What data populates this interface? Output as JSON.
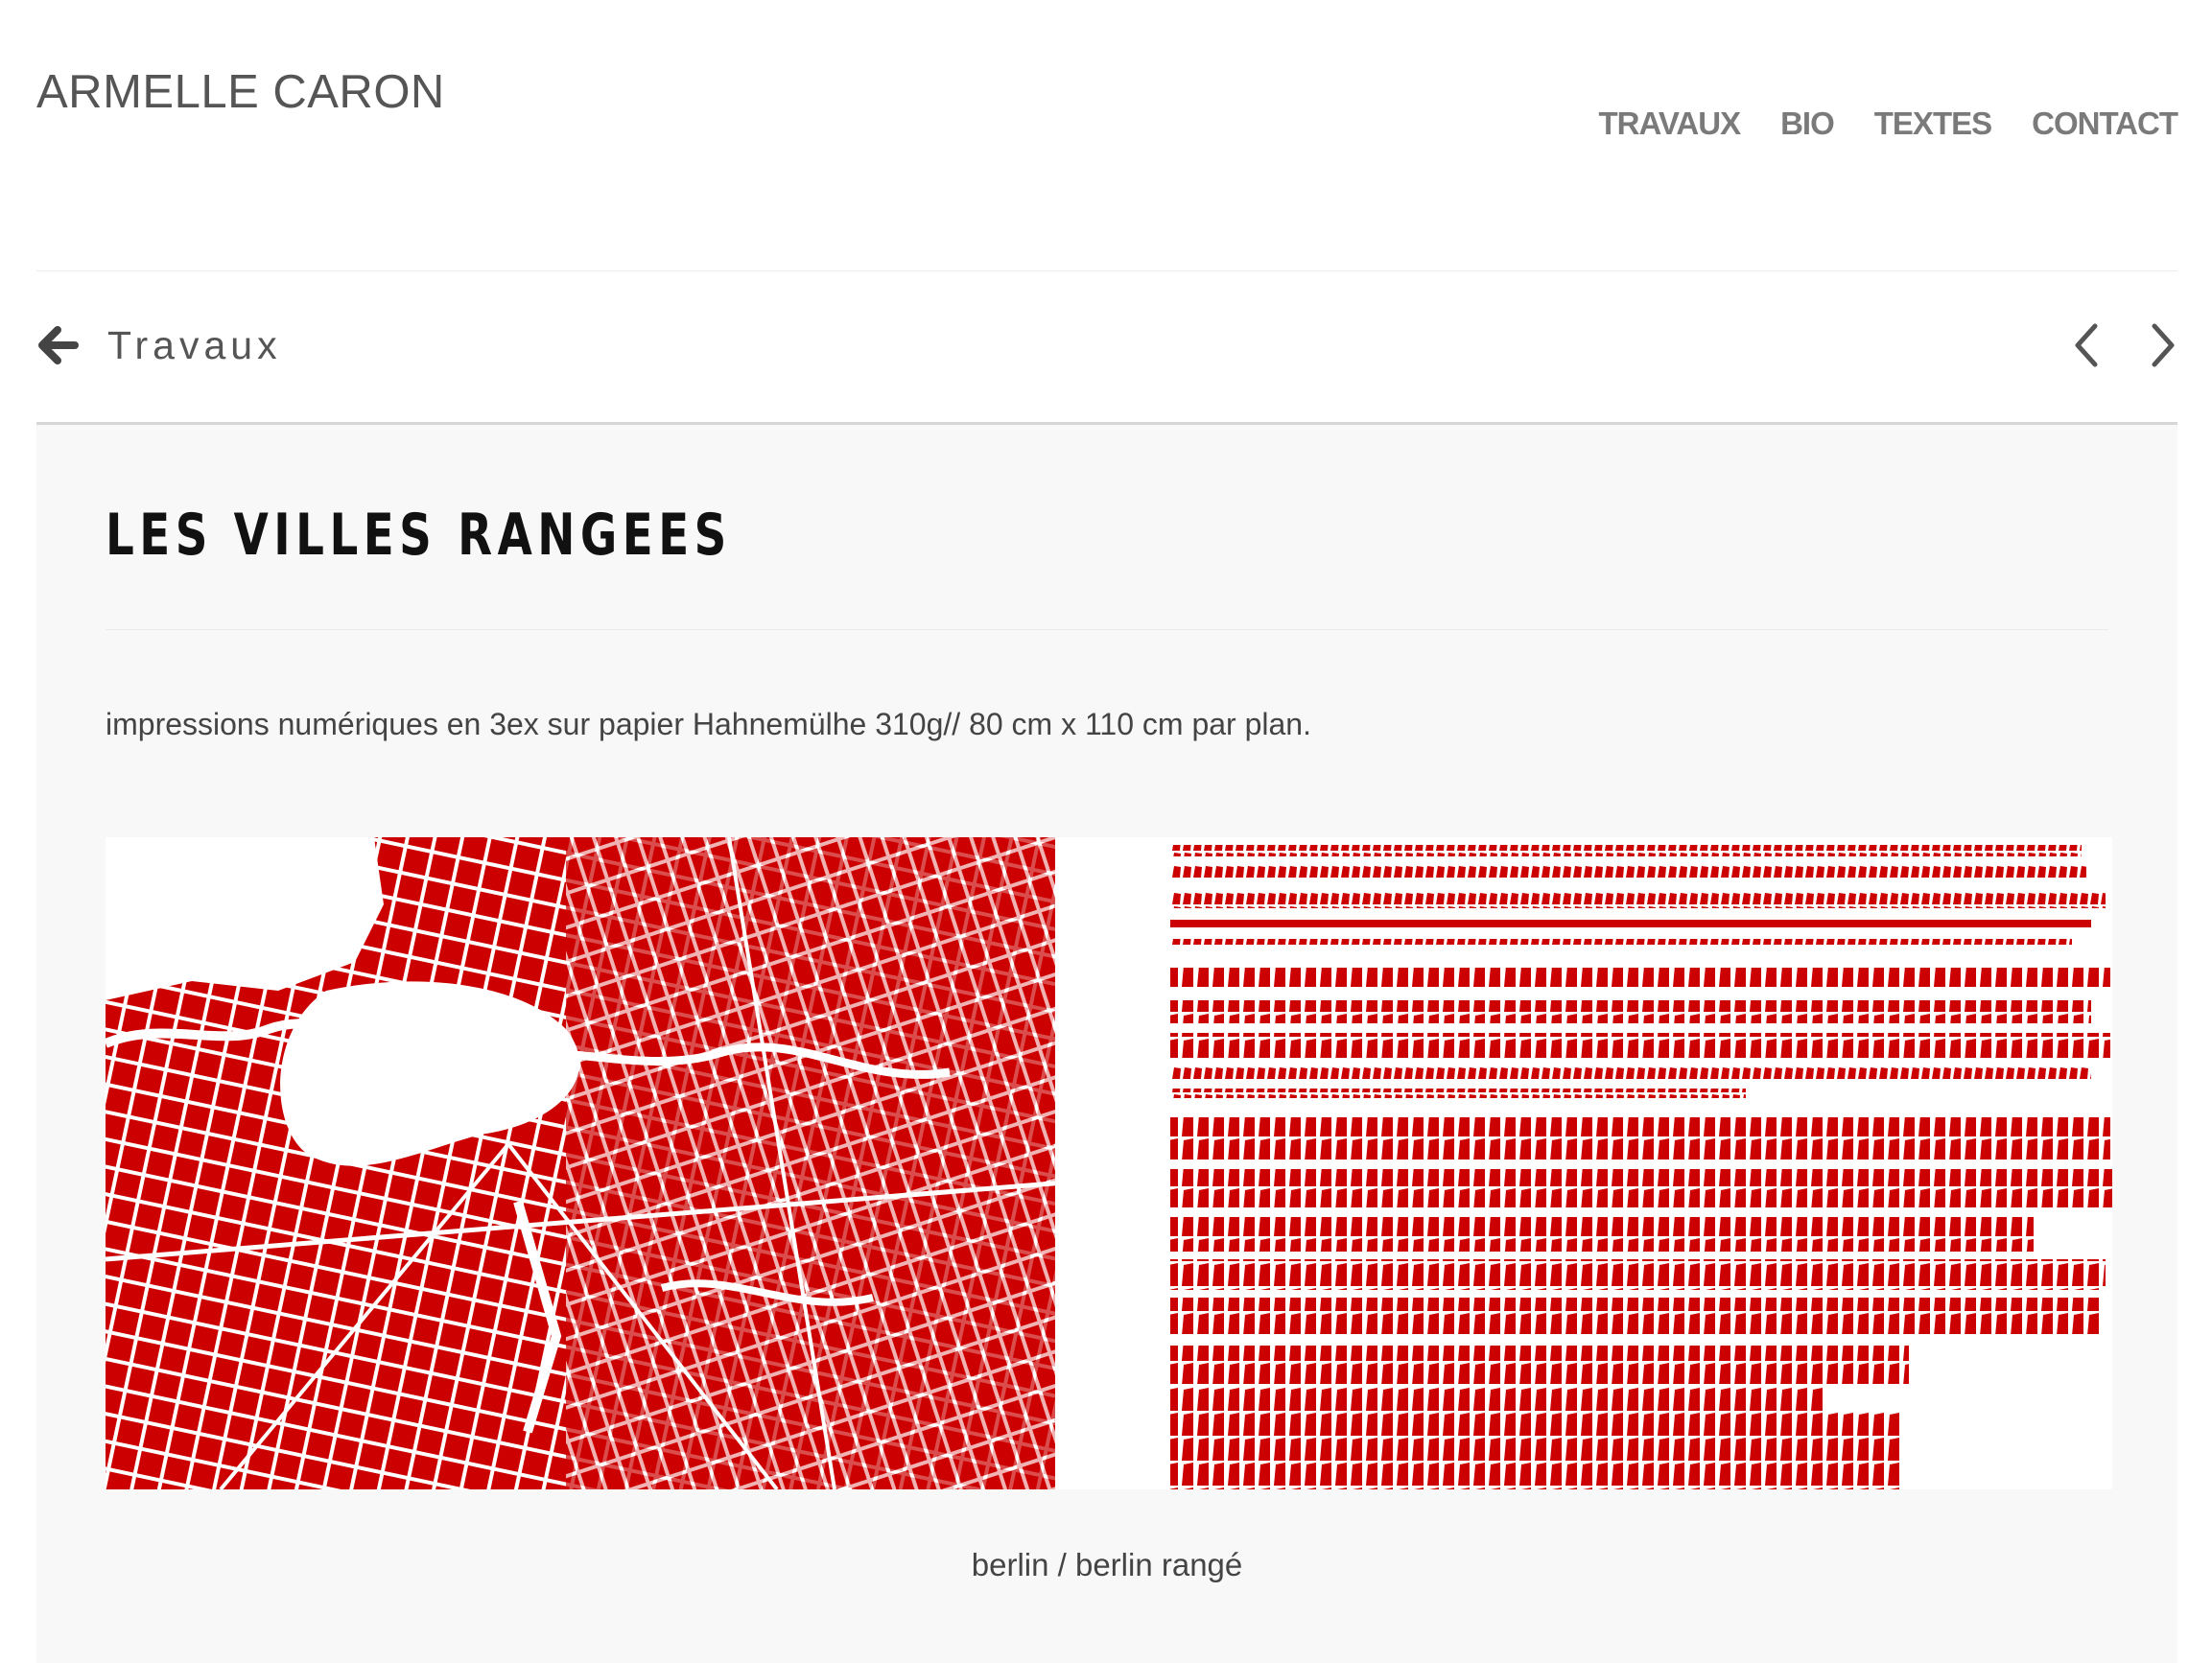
{
  "site": {
    "title": "ARMELLE CARON"
  },
  "nav": {
    "items": [
      "TRAVAUX",
      "BIO",
      "TEXTES",
      "CONTACT"
    ]
  },
  "breadcrumb": {
    "back_label": "Travaux"
  },
  "project": {
    "title": "LES VILLES RANGEES",
    "description": "impressions numériques en 3ex sur papier Hahnemülhe 310g// 80 cm x 110 cm par plan.",
    "caption": "berlin / berlin rangé"
  },
  "colors": {
    "accent": "#cc0000",
    "panel": "#f8f8f8",
    "nav": "#7a7a7a"
  },
  "icons": [
    "arrow-left-icon",
    "chevron-left-icon",
    "chevron-right-icon"
  ]
}
